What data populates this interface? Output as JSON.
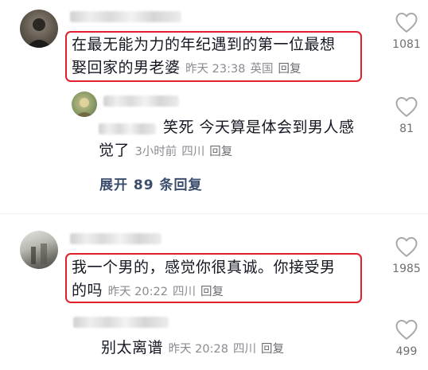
{
  "comments": [
    {
      "text_line1": "在最无能为力的年纪遇到的第一位最想",
      "text_line2": "娶回家的男老婆",
      "time": "昨天 23:38",
      "location": "英国",
      "reply": "回复",
      "likes": "1081"
    },
    {
      "text_line1": "笑死 今天算是体会到男人感",
      "text_line2": "觉了",
      "time": "3小时前",
      "location": "四川",
      "reply": "回复",
      "likes": "81"
    },
    {
      "text_line1": "我一个男的，感觉你很真诚。你接受男",
      "text_line2": "的吗",
      "time": "昨天 20:22",
      "location": "四川",
      "reply": "回复",
      "likes": "1985"
    },
    {
      "text_line1": "别太离谱",
      "time": "昨天 20:28",
      "location": "四川",
      "reply": "回复",
      "likes": "499"
    }
  ],
  "expand_replies": "展开 89 条回复",
  "colors": {
    "highlight": "#e0202a",
    "meta": "#8a8b91",
    "link": "#3b4d6d"
  },
  "icons": [
    "heart-outline-icon"
  ]
}
